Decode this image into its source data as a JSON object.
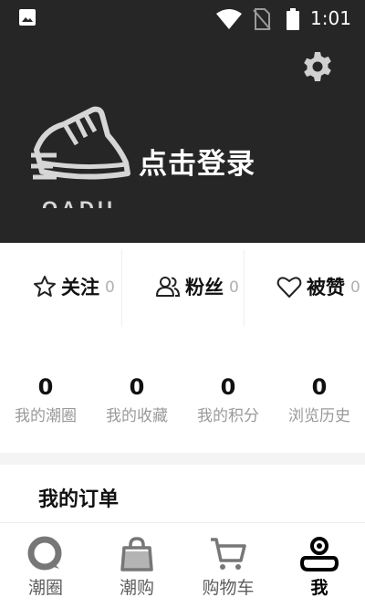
{
  "status_bar": {
    "time": "1:01",
    "icons": [
      "gallery-icon",
      "wifi-icon",
      "no-sim-icon",
      "battery-icon"
    ]
  },
  "header": {
    "login_text": "点击登录",
    "logo_partial_text": "OADIL",
    "settings_icon": "gear-icon",
    "background_color": "#262626"
  },
  "social": [
    {
      "icon": "star-icon",
      "label": "关注",
      "count": "0"
    },
    {
      "icon": "fans-icon",
      "label": "粉丝",
      "count": "0"
    },
    {
      "icon": "heart-icon",
      "label": "被赞",
      "count": "0"
    }
  ],
  "stats": [
    {
      "value": "0",
      "label": "我的潮圈"
    },
    {
      "value": "0",
      "label": "我的收藏"
    },
    {
      "value": "0",
      "label": "我的积分"
    },
    {
      "value": "0",
      "label": "浏览历史"
    }
  ],
  "orders": {
    "title": "我的订单"
  },
  "bottom_nav": [
    {
      "label": "潮圈",
      "icon": "circle-chat-icon",
      "active": false
    },
    {
      "label": "潮购",
      "icon": "shopping-bag-icon",
      "active": false
    },
    {
      "label": "购物车",
      "icon": "cart-icon",
      "active": false
    },
    {
      "label": "我",
      "icon": "profile-icon",
      "active": true
    }
  ],
  "colors": {
    "inactive_icon": "#777777",
    "active": "#000000",
    "muted_text": "#9a9a9a"
  }
}
